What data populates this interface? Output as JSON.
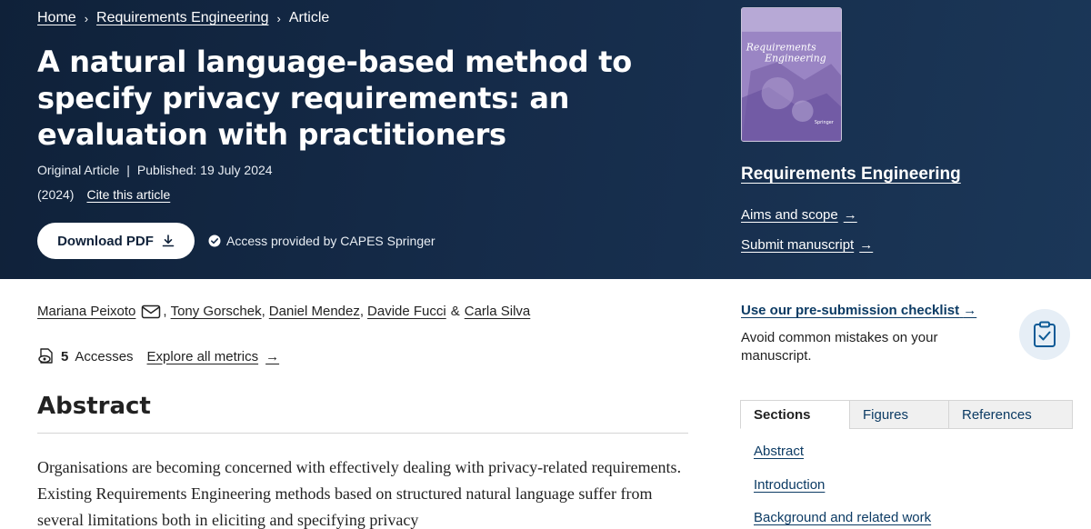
{
  "breadcrumb": {
    "home": "Home",
    "journal": "Requirements Engineering",
    "current": "Article",
    "separator": "›"
  },
  "article": {
    "title": "A natural language-based method to specify privacy requirements: an evaluation with practitioners",
    "type": "Original Article",
    "published": "Published: 19 July 2024",
    "year": "(2024)",
    "cite_label": "Cite this article",
    "download_label": "Download PDF",
    "access_text": "Access provided by CAPES Springer"
  },
  "journal_panel": {
    "journal_name": "Requirements Engineering",
    "aims_label": "Aims and scope",
    "submit_label": "Submit manuscript",
    "arrow": "→"
  },
  "cover": {
    "title_line1": "Requirements",
    "title_line2": "Engineering",
    "publisher": "Springer"
  },
  "authors": [
    {
      "name": "Mariana Peixoto"
    },
    {
      "name": "Tony Gorschek"
    },
    {
      "name": "Daniel Mendez"
    },
    {
      "name": "Davide Fucci"
    },
    {
      "name": "Carla Silva"
    }
  ],
  "authors_sep": {
    "comma": ",",
    "amp": "&"
  },
  "metrics": {
    "count": "5",
    "label": "Accesses",
    "explore_label": "Explore all metrics",
    "arrow": "→"
  },
  "abstract": {
    "heading": "Abstract",
    "text": "Organisations are becoming concerned with effectively dealing with privacy-related requirements. Existing Requirements Engineering methods based on structured natural language suffer from several limitations both in eliciting and specifying privacy"
  },
  "checklist": {
    "link_label": "Use our pre-submission checklist",
    "arrow": "→",
    "description": "Avoid common mistakes on your manuscript."
  },
  "tabs": [
    {
      "label": "Sections",
      "active": true
    },
    {
      "label": "Figures",
      "active": false
    },
    {
      "label": "References",
      "active": false
    }
  ],
  "toc": [
    "Abstract",
    "Introduction",
    "Background and related work"
  ],
  "colors": {
    "hero_bg": "#152b49",
    "link_blue": "#0c3b64",
    "cover_purple": "#8c74b9"
  }
}
